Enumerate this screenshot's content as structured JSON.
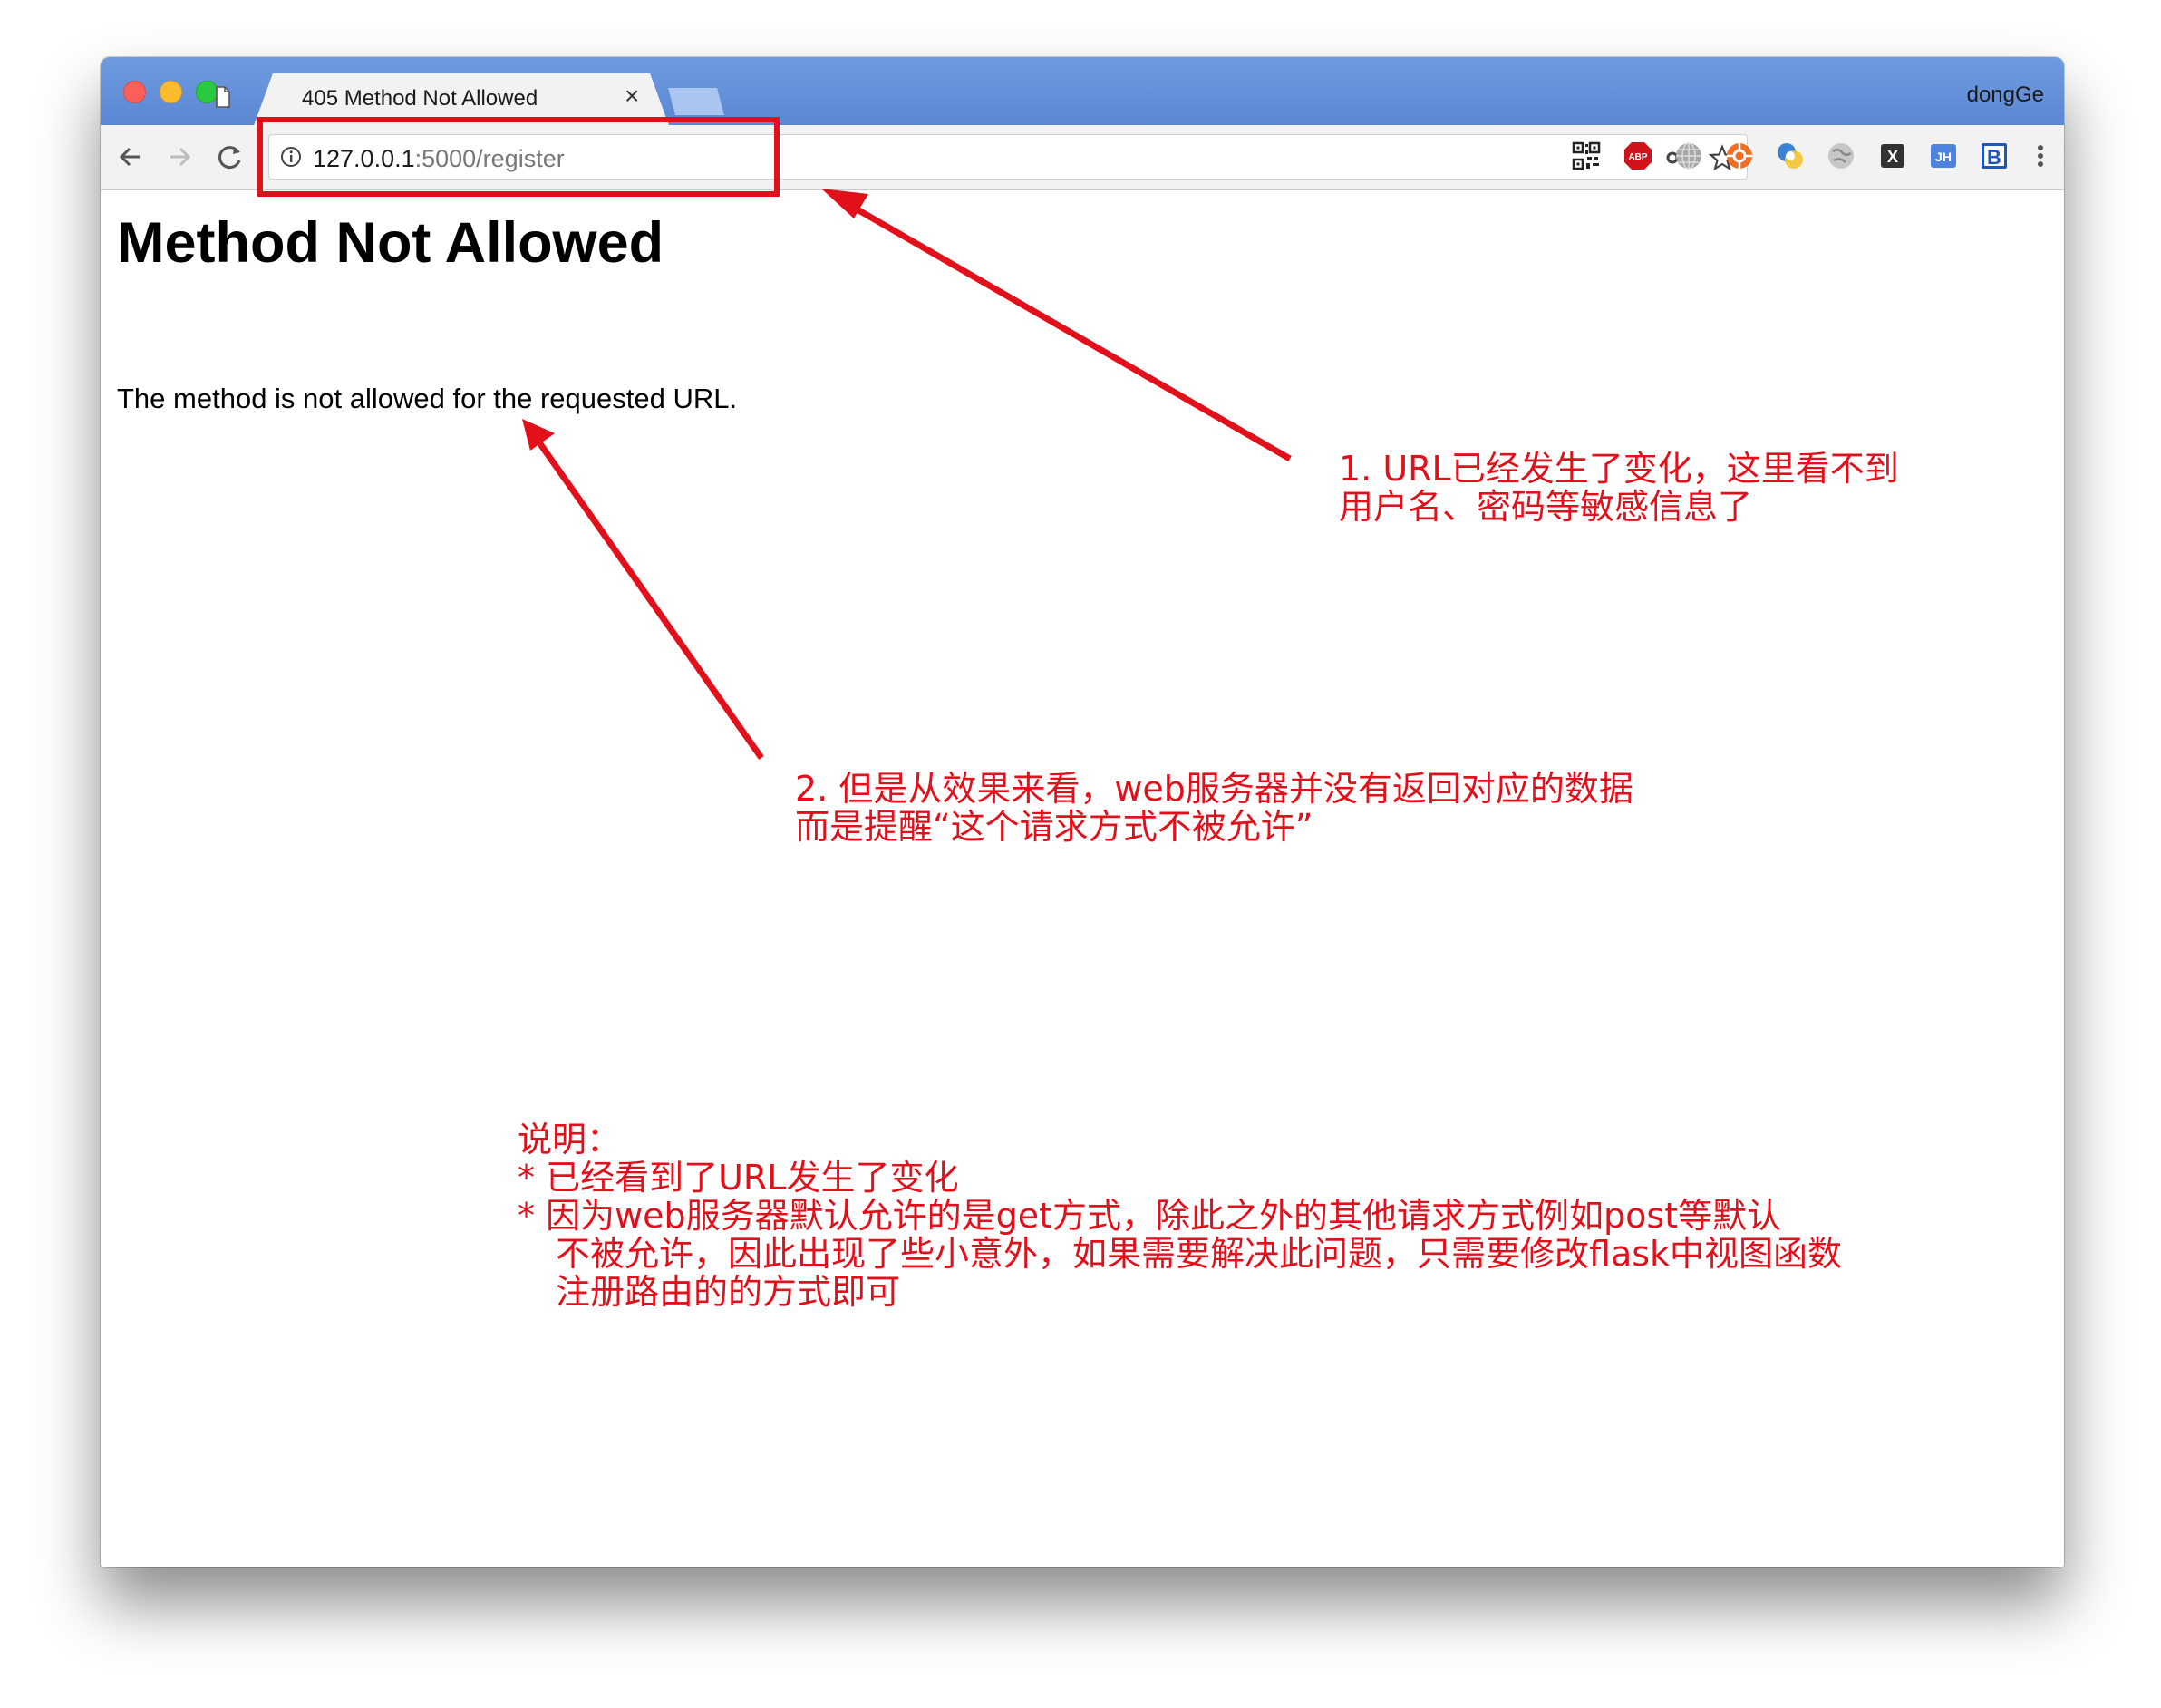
{
  "window": {
    "profile_name": "dongGe",
    "tab": {
      "title": "405 Method Not Allowed",
      "close_glyph": "×"
    }
  },
  "toolbar": {
    "url_host": "127.0.0.1",
    "url_path": ":5000/register",
    "extensions": [
      "qr-code-icon",
      "adblock-plus-icon",
      "globe-icon",
      "orange-circle-icon",
      "translate-icon",
      "gray-globe-icon",
      "x-extension-icon",
      "jh-extension-icon",
      "b-extension-icon",
      "menu-dots-icon"
    ],
    "extension_labels": {
      "adblock": "ABP",
      "jh": "JH",
      "b": "B",
      "x": "X"
    }
  },
  "page": {
    "heading": "Method Not Allowed",
    "paragraph": "The method is not allowed for the requested URL."
  },
  "annotations": {
    "note1": [
      "1. URL已经发生了变化，这里看不到",
      "用户名、密码等敏感信息了"
    ],
    "note2": [
      "2. 但是从效果来看，web服务器并没有返回对应的数据",
      "而是提醒“这个请求方式不被允许”"
    ],
    "note3": [
      "说明：",
      "*  已经看到了URL发生了变化",
      "*  因为web服务器默认允许的是get方式，除此之外的其他请求方式例如post等默认",
      "不被允许，因此出现了些小意外，如果需要解决此问题，只需要修改flask中视图函数",
      "注册路由的的方式即可"
    ],
    "color": "#e2101b"
  },
  "theme": {
    "titlebar": "#5b87d3",
    "toolbar": "#f2f2f2",
    "annotation_red": "#e2101b"
  }
}
